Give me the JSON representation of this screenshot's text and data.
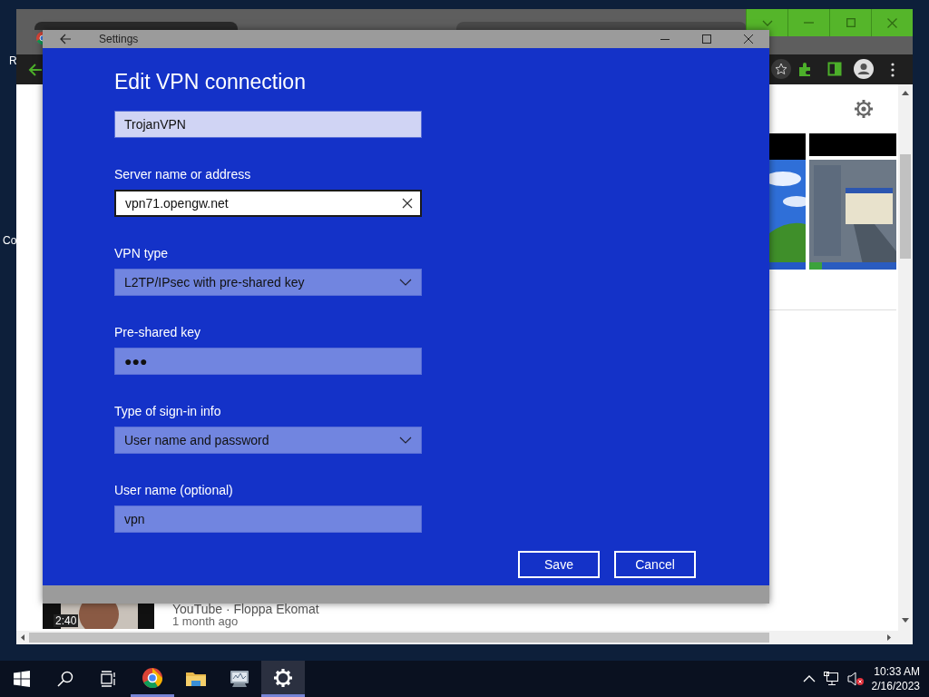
{
  "desktop": {
    "icon_labels": [
      "R",
      "Co"
    ]
  },
  "browser": {
    "video": {
      "duration": "2:40",
      "source": "YouTube · Floppa Ekomat",
      "age": "1 month ago"
    }
  },
  "settings_window": {
    "title": "Settings",
    "heading": "Edit VPN connection",
    "fields": [
      {
        "kind": "text",
        "value": "TrojanVPN",
        "focused": false,
        "highlighted": true
      },
      {
        "kind": "text",
        "label": "Server name or address",
        "value": "vpn71.opengw.net",
        "focused": true,
        "highlighted": false
      },
      {
        "kind": "dropdown",
        "label": "VPN type",
        "value": "L2TP/IPsec with pre-shared key",
        "focused": false,
        "highlighted": false
      },
      {
        "kind": "text",
        "label": "Pre-shared key",
        "value": "●●●",
        "focused": false,
        "highlighted": false
      },
      {
        "kind": "dropdown",
        "label": "Type of sign-in info",
        "value": "User name and password",
        "focused": false,
        "highlighted": false
      },
      {
        "kind": "text",
        "label": "User name (optional)",
        "value": "vpn",
        "focused": false,
        "highlighted": false
      }
    ],
    "buttons": [
      "Save",
      "Cancel"
    ]
  },
  "taskbar": {
    "apps": [
      {
        "kind": "chrome",
        "open": true,
        "selected": false
      },
      {
        "kind": "folder",
        "open": false,
        "selected": false
      },
      {
        "kind": "monitor",
        "open": false,
        "selected": false
      },
      {
        "kind": "settings",
        "open": true,
        "selected": true
      }
    ],
    "clock": {
      "time": "10:33 AM",
      "date": "2/16/2023"
    }
  }
}
